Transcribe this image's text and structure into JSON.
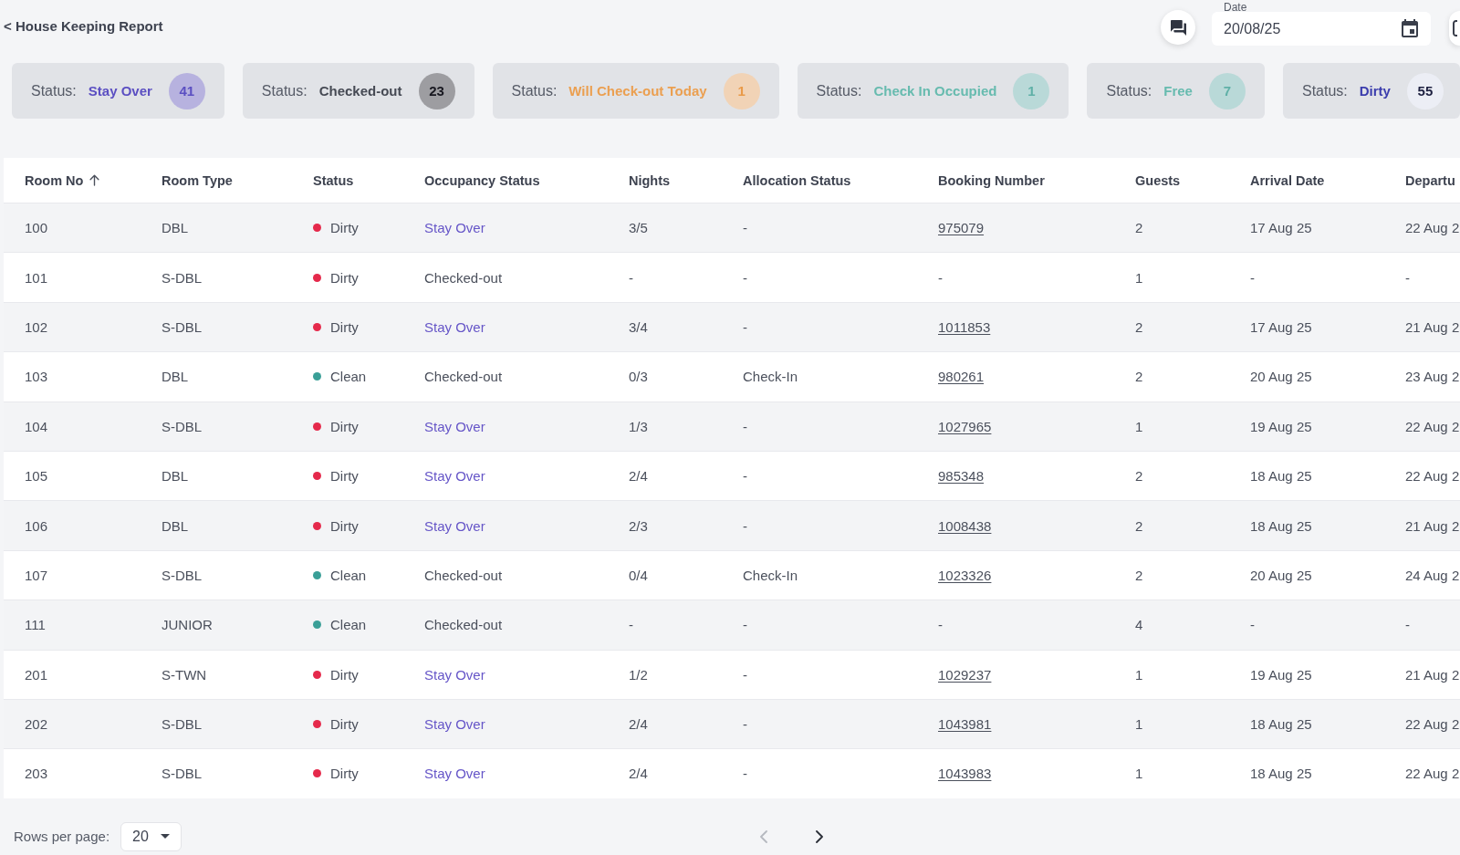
{
  "header": {
    "back_title": "< House Keeping Report",
    "date_field": {
      "label": "Date",
      "value": "20/08/25"
    }
  },
  "status_cards": [
    {
      "label": "Status:",
      "value": {
        "text": "Stay Over",
        "color": "#5b4fc2"
      },
      "badge": {
        "color": "#b7b2df",
        "count": {
          "text": "41",
          "color": "#5b4fc2"
        }
      }
    },
    {
      "label": "Status:",
      "value": {
        "text": "Checked-out",
        "color": "#464a54"
      },
      "badge": {
        "color": "#9d9da1",
        "count": {
          "text": "23",
          "color": "#17171f"
        }
      }
    },
    {
      "label": "Status:",
      "value": {
        "text": "Will Check-out Today",
        "color": "#eb9f50"
      },
      "badge": {
        "color": "#f1d3b6",
        "count": {
          "text": "1",
          "color": "#e99a48"
        }
      }
    },
    {
      "label": "Status:",
      "value": {
        "text": "Check In Occupied",
        "color": "#67bbaf"
      },
      "badge": {
        "color": "#b9d9d8",
        "count": {
          "text": "1",
          "color": "#5fb0a7"
        }
      }
    },
    {
      "label": "Status:",
      "value": {
        "text": "Free",
        "color": "#67bbaf"
      },
      "badge": {
        "color": "#b9d9d8",
        "count": {
          "text": "7",
          "color": "#5fb0a7"
        }
      }
    },
    {
      "label": "Status:",
      "value": {
        "text": "Dirty",
        "color": "#3b3dad"
      },
      "badge": {
        "color": "#eceef5",
        "count": {
          "text": "55",
          "color": "#1d2040"
        }
      }
    }
  ],
  "table": {
    "columns": [
      {
        "label": "Room No",
        "sorted": true
      },
      {
        "label": "Room Type",
        "sorted": false
      },
      {
        "label": "Status",
        "sorted": false
      },
      {
        "label": "Occupancy Status",
        "sorted": false
      },
      {
        "label": "Nights",
        "sorted": false
      },
      {
        "label": "Allocation Status",
        "sorted": false
      },
      {
        "label": "Booking Number",
        "sorted": false
      },
      {
        "label": "Guests",
        "sorted": false
      },
      {
        "label": "Arrival Date",
        "sorted": false
      },
      {
        "label": "Departu",
        "sorted": false
      }
    ],
    "rows": [
      {
        "room_no": "100",
        "room_type": "DBL",
        "status": {
          "text": "Dirty",
          "color": "#e5294b"
        },
        "occupancy": {
          "text": "Stay Over",
          "color": "#6656c8"
        },
        "nights": "3/5",
        "allocation": "-",
        "booking": {
          "text": "975079",
          "link": true
        },
        "guests": "2",
        "arrival": "17 Aug 25",
        "departure": "22 Aug 2"
      },
      {
        "room_no": "101",
        "room_type": "S-DBL",
        "status": {
          "text": "Dirty",
          "color": "#e5294b"
        },
        "occupancy": {
          "text": "Checked-out",
          "color": "#4b505c"
        },
        "nights": "-",
        "allocation": "-",
        "booking": {
          "text": "-",
          "link": false
        },
        "guests": "1",
        "arrival": "-",
        "departure": "-"
      },
      {
        "room_no": "102",
        "room_type": "S-DBL",
        "status": {
          "text": "Dirty",
          "color": "#e5294b"
        },
        "occupancy": {
          "text": "Stay Over",
          "color": "#6656c8"
        },
        "nights": "3/4",
        "allocation": "-",
        "booking": {
          "text": "1011853",
          "link": true
        },
        "guests": "2",
        "arrival": "17 Aug 25",
        "departure": "21 Aug 2"
      },
      {
        "room_no": "103",
        "room_type": "DBL",
        "status": {
          "text": "Clean",
          "color": "#3a9f97"
        },
        "occupancy": {
          "text": "Checked-out",
          "color": "#4b505c"
        },
        "nights": "0/3",
        "allocation": "Check-In",
        "booking": {
          "text": "980261",
          "link": true
        },
        "guests": "2",
        "arrival": "20 Aug 25",
        "departure": "23 Aug 2"
      },
      {
        "room_no": "104",
        "room_type": "S-DBL",
        "status": {
          "text": "Dirty",
          "color": "#e5294b"
        },
        "occupancy": {
          "text": "Stay Over",
          "color": "#6656c8"
        },
        "nights": "1/3",
        "allocation": "-",
        "booking": {
          "text": "1027965",
          "link": true
        },
        "guests": "1",
        "arrival": "19 Aug 25",
        "departure": "22 Aug 2"
      },
      {
        "room_no": "105",
        "room_type": "DBL",
        "status": {
          "text": "Dirty",
          "color": "#e5294b"
        },
        "occupancy": {
          "text": "Stay Over",
          "color": "#6656c8"
        },
        "nights": "2/4",
        "allocation": "-",
        "booking": {
          "text": "985348",
          "link": true
        },
        "guests": "2",
        "arrival": "18 Aug 25",
        "departure": "22 Aug 2"
      },
      {
        "room_no": "106",
        "room_type": "DBL",
        "status": {
          "text": "Dirty",
          "color": "#e5294b"
        },
        "occupancy": {
          "text": "Stay Over",
          "color": "#6656c8"
        },
        "nights": "2/3",
        "allocation": "-",
        "booking": {
          "text": "1008438",
          "link": true
        },
        "guests": "2",
        "arrival": "18 Aug 25",
        "departure": "21 Aug 2"
      },
      {
        "room_no": "107",
        "room_type": "S-DBL",
        "status": {
          "text": "Clean",
          "color": "#3a9f97"
        },
        "occupancy": {
          "text": "Checked-out",
          "color": "#4b505c"
        },
        "nights": "0/4",
        "allocation": "Check-In",
        "booking": {
          "text": "1023326",
          "link": true
        },
        "guests": "2",
        "arrival": "20 Aug 25",
        "departure": "24 Aug 2"
      },
      {
        "room_no": "111",
        "room_type": "JUNIOR",
        "status": {
          "text": "Clean",
          "color": "#3a9f97"
        },
        "occupancy": {
          "text": "Checked-out",
          "color": "#4b505c"
        },
        "nights": "-",
        "allocation": "-",
        "booking": {
          "text": "-",
          "link": false
        },
        "guests": "4",
        "arrival": "-",
        "departure": "-"
      },
      {
        "room_no": "201",
        "room_type": "S-TWN",
        "status": {
          "text": "Dirty",
          "color": "#e5294b"
        },
        "occupancy": {
          "text": "Stay Over",
          "color": "#6656c8"
        },
        "nights": "1/2",
        "allocation": "-",
        "booking": {
          "text": "1029237",
          "link": true
        },
        "guests": "1",
        "arrival": "19 Aug 25",
        "departure": "21 Aug 2"
      },
      {
        "room_no": "202",
        "room_type": "S-DBL",
        "status": {
          "text": "Dirty",
          "color": "#e5294b"
        },
        "occupancy": {
          "text": "Stay Over",
          "color": "#6656c8"
        },
        "nights": "2/4",
        "allocation": "-",
        "booking": {
          "text": "1043981",
          "link": true
        },
        "guests": "1",
        "arrival": "18 Aug 25",
        "departure": "22 Aug 2"
      },
      {
        "room_no": "203",
        "room_type": "S-DBL",
        "status": {
          "text": "Dirty",
          "color": "#e5294b"
        },
        "occupancy": {
          "text": "Stay Over",
          "color": "#6656c8"
        },
        "nights": "2/4",
        "allocation": "-",
        "booking": {
          "text": "1043983",
          "link": true
        },
        "guests": "1",
        "arrival": "18 Aug 25",
        "departure": "22 Aug 2"
      }
    ]
  },
  "footer": {
    "rows_per_page_label": "Rows per page:",
    "rows_per_page": "20",
    "previous": {
      "disabled": true
    },
    "next": {
      "disabled": false
    }
  }
}
